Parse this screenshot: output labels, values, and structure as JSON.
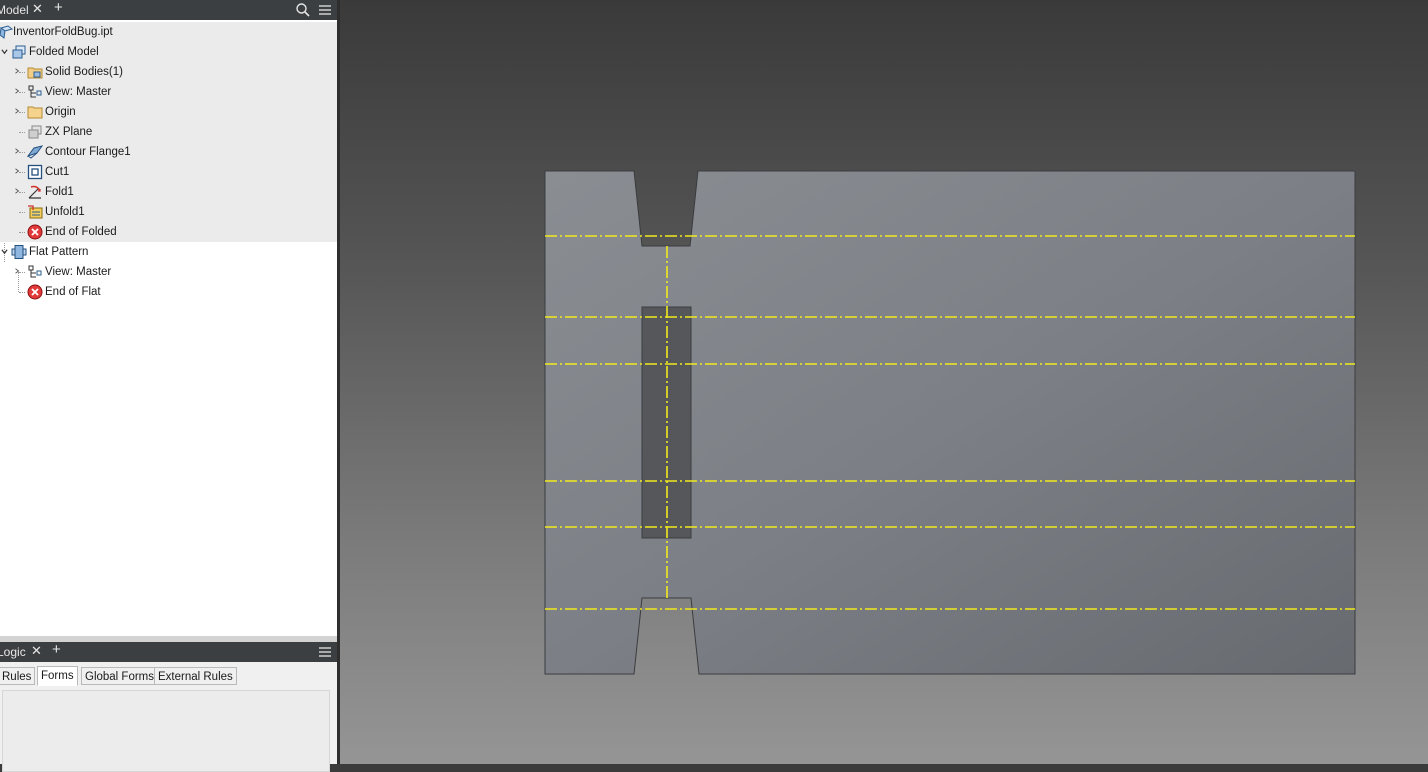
{
  "model_panel": {
    "tab_label": "Model",
    "close_icon": "close-icon",
    "add_icon": "plus-icon",
    "search_icon": "search-icon",
    "menu_icon": "hamburger-menu-icon"
  },
  "tree": {
    "root": {
      "label": "InventorFoldBug.ipt",
      "icon": "part-icon"
    },
    "folded": {
      "label": "Folded Model",
      "icon": "folded-model-icon",
      "children": [
        {
          "label": "Solid Bodies(1)",
          "icon": "solid-bodies-folder-icon",
          "expandable": true
        },
        {
          "label": "View: Master",
          "icon": "view-rep-icon",
          "expandable": true
        },
        {
          "label": "Origin",
          "icon": "origin-folder-icon",
          "expandable": true
        },
        {
          "label": "ZX Plane",
          "icon": "work-plane-icon",
          "expandable": false
        },
        {
          "label": "Contour Flange1",
          "icon": "contour-flange-icon",
          "expandable": true
        },
        {
          "label": "Cut1",
          "icon": "cut-icon",
          "expandable": true
        },
        {
          "label": "Fold1",
          "icon": "fold-icon",
          "expandable": true
        },
        {
          "label": "Unfold1",
          "icon": "unfold-icon",
          "expandable": false
        },
        {
          "label": "End of Folded",
          "icon": "end-of-part-icon",
          "expandable": false
        }
      ]
    },
    "flat": {
      "label": "Flat Pattern",
      "icon": "flat-pattern-icon",
      "children": [
        {
          "label": "View: Master",
          "icon": "view-rep-icon",
          "expandable": true
        },
        {
          "label": "End of Flat",
          "icon": "end-of-part-icon",
          "expandable": false
        }
      ]
    }
  },
  "logic_panel": {
    "tab_label": "Logic",
    "close_icon": "close-icon",
    "add_icon": "plus-icon",
    "menu_icon": "hamburger-menu-icon",
    "tabs": [
      {
        "label": "Rules",
        "active": false
      },
      {
        "label": "Forms",
        "active": true
      },
      {
        "label": "Global Forms",
        "active": false
      },
      {
        "label": "External Rules",
        "active": false
      }
    ]
  },
  "viewport": {
    "bend_line_color": "#f2ea1e",
    "sheet_color": "#7c8187",
    "cutout_color": "#55575a",
    "edge_color": "#3a3c3f"
  }
}
